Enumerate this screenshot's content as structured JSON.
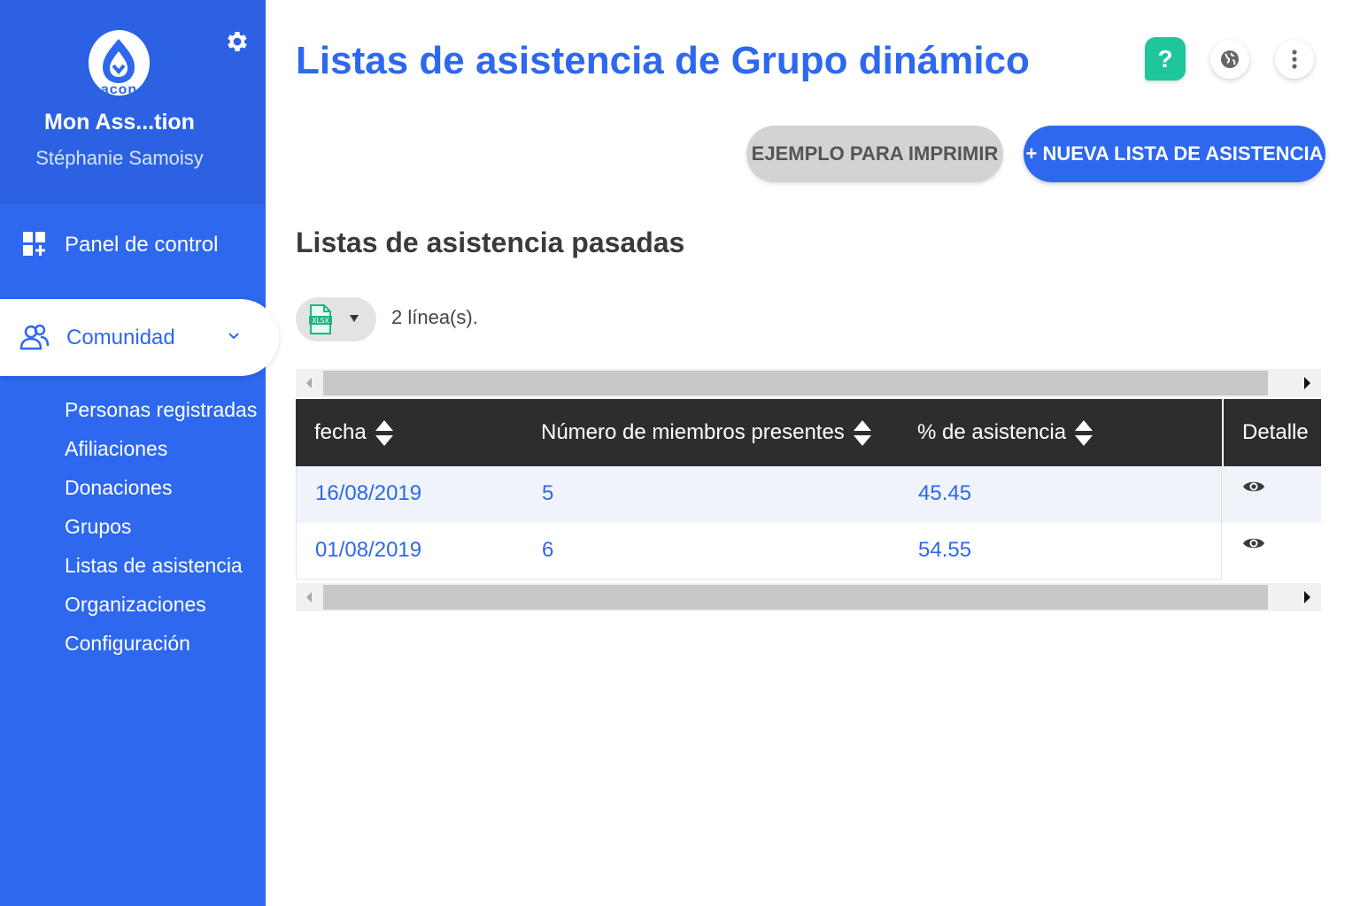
{
  "sidebar": {
    "logo_text": "acon",
    "org_name": "Mon Ass...tion",
    "user_name": "Stéphanie Samoisy",
    "dashboard_label": "Panel de control",
    "community_label": "Comunidad",
    "sub_items": [
      {
        "label": "Personas registradas"
      },
      {
        "label": "Afiliaciones"
      },
      {
        "label": "Donaciones"
      },
      {
        "label": "Grupos"
      },
      {
        "label": "Listas de asistencia"
      },
      {
        "label": "Organizaciones"
      },
      {
        "label": "Configuración"
      }
    ]
  },
  "header": {
    "title": "Listas de asistencia de Grupo dinámico",
    "help_label": "?"
  },
  "actions": {
    "print_label": "EJEMPLO PARA IMPRIMIR",
    "new_label": "+ NUEVA LISTA DE ASISTENCIA"
  },
  "section": {
    "title": "Listas de asistencia pasadas",
    "export_icon_label": "XLSX",
    "row_count": "2 línea(s)."
  },
  "table": {
    "columns": [
      "fecha",
      "Número de miembros presentes",
      "% de asistencia",
      "Detalle"
    ],
    "rows": [
      {
        "fecha": "16/08/2019",
        "miembros": "5",
        "asistencia": "45.45"
      },
      {
        "fecha": "01/08/2019",
        "miembros": "6",
        "asistencia": "54.55"
      }
    ]
  },
  "colors": {
    "primary": "#2d68ee",
    "help": "#1fc59b",
    "table_header": "#2d2d2d"
  }
}
